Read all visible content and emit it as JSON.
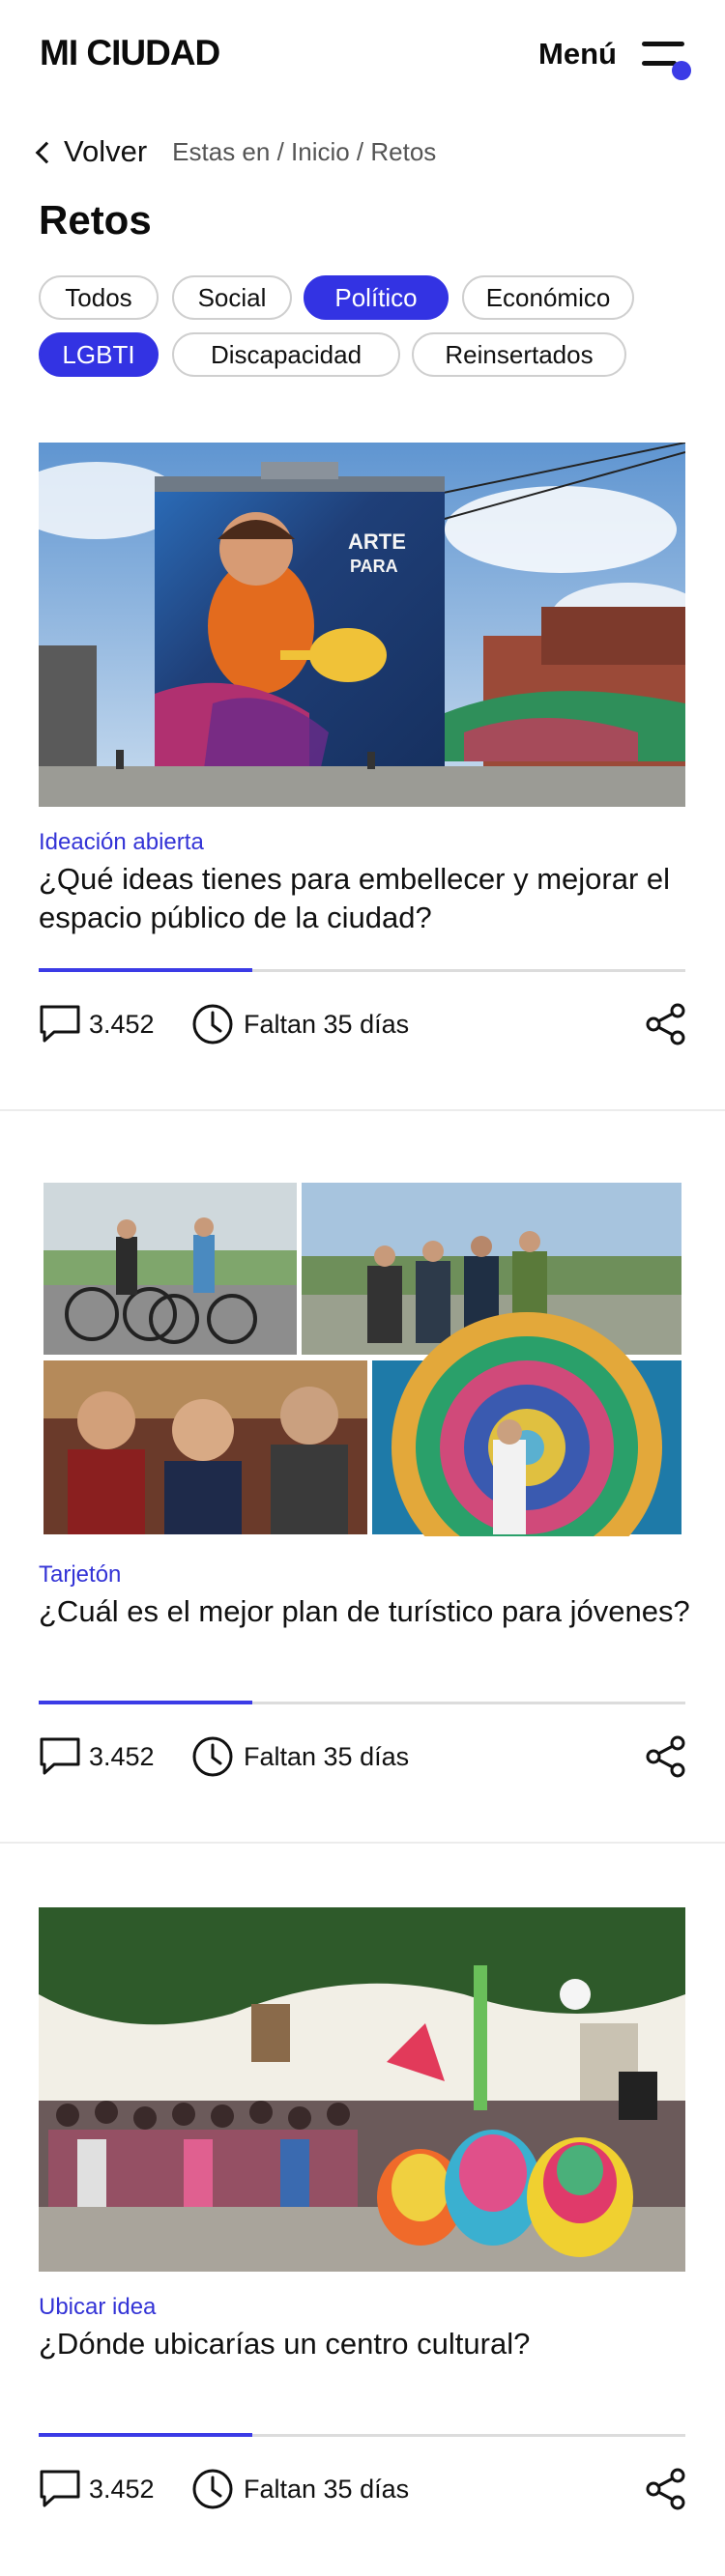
{
  "header": {
    "logo": "MI CIUDAD",
    "menu_label": "Menú",
    "accent": "#3333e3"
  },
  "breadcrumb": {
    "back_label": "Volver",
    "trail": "Estas en / Inicio / Retos"
  },
  "page_title": "Retos",
  "filters": [
    {
      "label": "Todos",
      "active": false
    },
    {
      "label": "Social",
      "active": false
    },
    {
      "label": "Político",
      "active": true
    },
    {
      "label": "Económico",
      "active": false
    },
    {
      "label": "LGBTI",
      "active": true
    },
    {
      "label": "Discapacidad",
      "active": false
    },
    {
      "label": "Reinsertados",
      "active": false
    }
  ],
  "cards": [
    {
      "tag": "Ideación abierta",
      "title": "¿Qué ideas tienes para embellecer y mejorar el espacio público de la ciudad?",
      "progress": 0.33,
      "comments": "3.452",
      "time_left": "Faltan 35 días",
      "image": "street-mural-photo"
    },
    {
      "tag": "Tarjetón",
      "title": "¿Cuál es el mejor plan de turístico para jóvenes?",
      "progress": 0.33,
      "comments": "3.452",
      "time_left": "Faltan 35 días",
      "image": "photo-collage"
    },
    {
      "tag": "Ubicar idea",
      "title": "¿Dónde ubicarías un centro cultural?",
      "progress": 0.33,
      "comments": "3.452",
      "time_left": "Faltan 35 días",
      "image": "street-performers-photo"
    }
  ],
  "icons": {
    "comment": "speech-bubble-icon",
    "time": "clock-icon",
    "share": "share-icon"
  }
}
